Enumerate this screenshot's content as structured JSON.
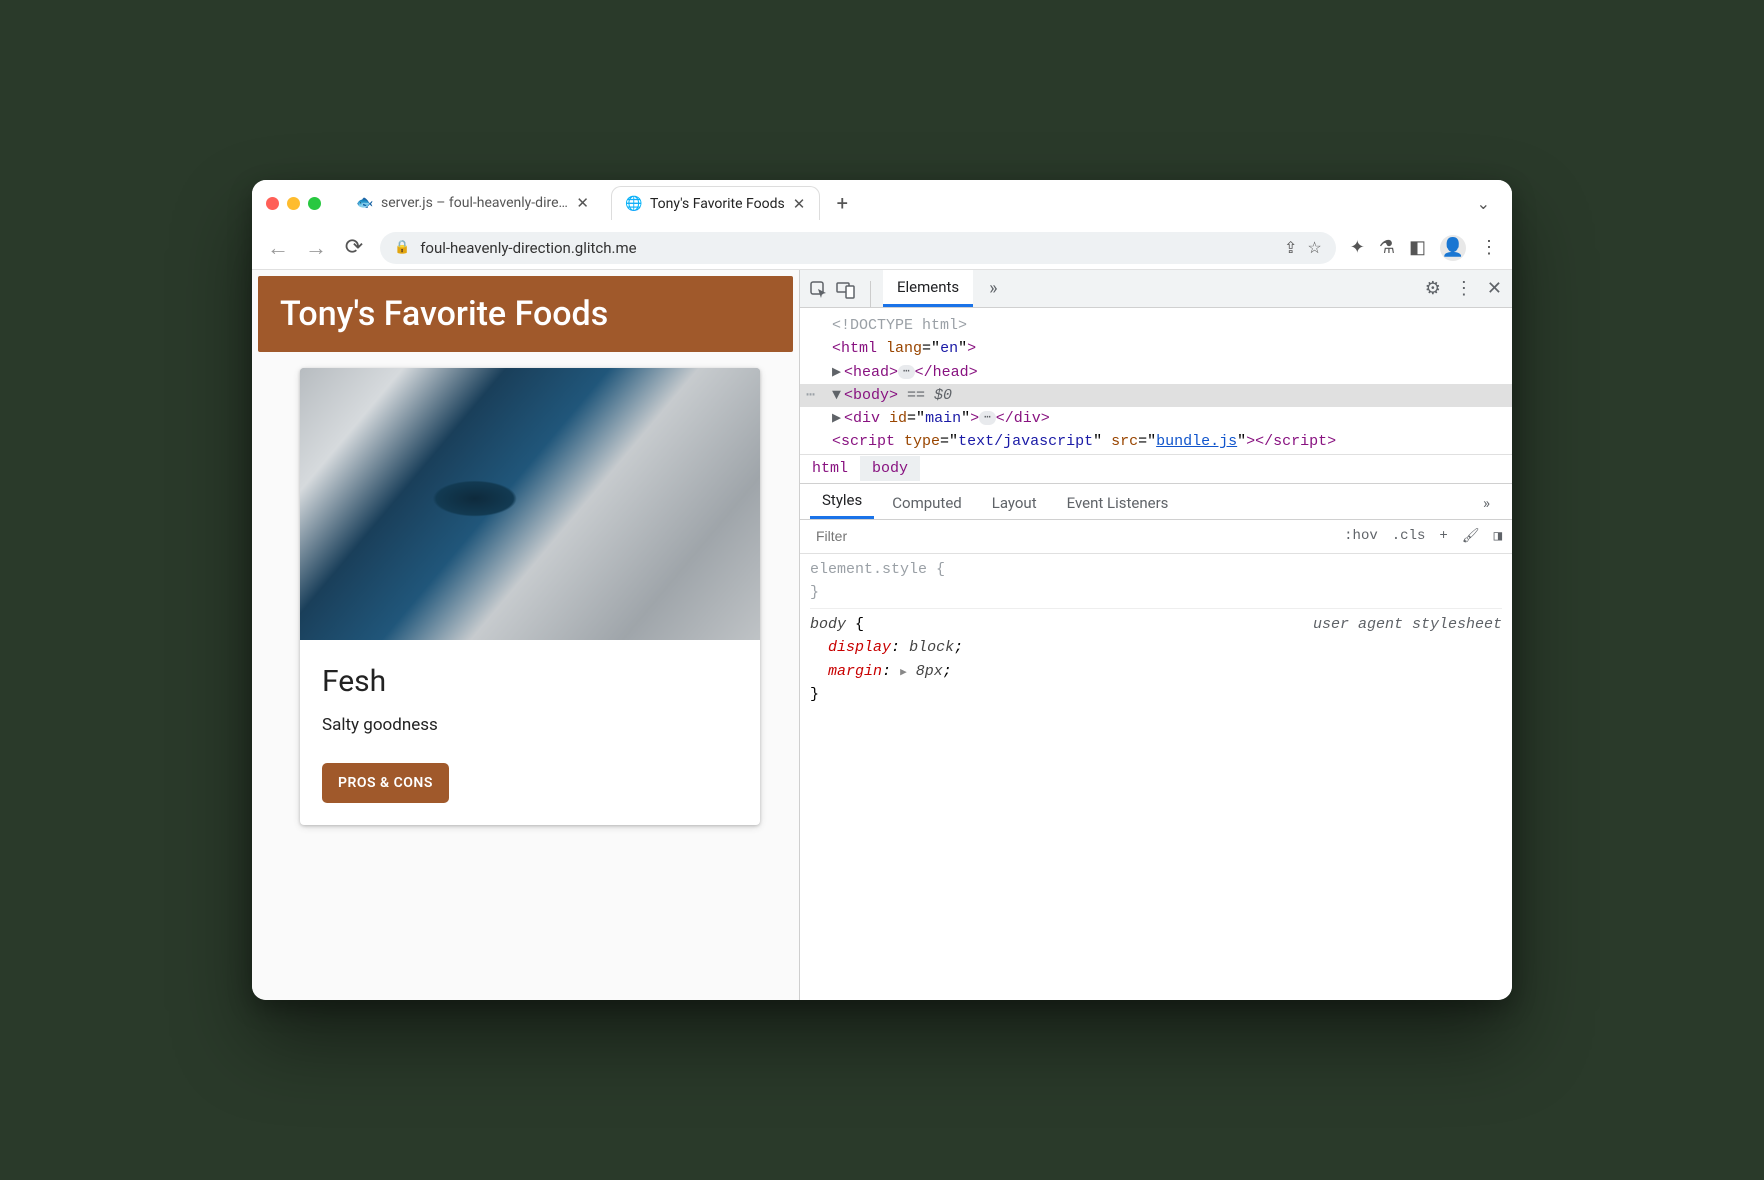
{
  "tabs": [
    {
      "title": "server.js – foul-heavenly-direct",
      "active": false
    },
    {
      "title": "Tony's Favorite Foods",
      "active": true
    }
  ],
  "address_bar": {
    "url": "foul-heavenly-direction.glitch.me"
  },
  "page": {
    "header_title": "Tony's Favorite Foods",
    "card": {
      "image_alt": "Fish",
      "title": "Fesh",
      "subtitle": "Salty goodness",
      "button_label": "PROS & CONS"
    }
  },
  "devtools": {
    "panel_tabs": {
      "active": "Elements",
      "overflow": "»"
    },
    "dom": {
      "doctype": "<!DOCTYPE html>",
      "html_open": {
        "tag": "html",
        "attrs": [
          [
            "lang",
            "en"
          ]
        ]
      },
      "head": {
        "tag": "head",
        "collapsed": true
      },
      "body_open": {
        "tag": "body",
        "selection_marker": "== $0"
      },
      "div_main": {
        "tag": "div",
        "attrs": [
          [
            "id",
            "main"
          ]
        ],
        "collapsed": true
      },
      "script_node": {
        "tag": "script",
        "attrs": [
          [
            "type",
            "text/javascript"
          ],
          [
            "src",
            "bundle.js"
          ]
        ],
        "src_is_link": true
      }
    },
    "breadcrumb": [
      "html",
      "body"
    ],
    "styles_tabs": [
      "Styles",
      "Computed",
      "Layout",
      "Event Listeners"
    ],
    "styles_active": "Styles",
    "styles_filter_placeholder": "Filter",
    "styles_toolbar_chips": [
      ":hov",
      ".cls",
      "+"
    ],
    "styles_rules": [
      {
        "selector": "element.style",
        "source": "",
        "declarations": []
      },
      {
        "selector": "body",
        "source": "user agent stylesheet",
        "declarations": [
          {
            "prop": "display",
            "val": "block"
          },
          {
            "prop": "margin",
            "val": "8px",
            "expandable": true
          }
        ]
      }
    ]
  }
}
